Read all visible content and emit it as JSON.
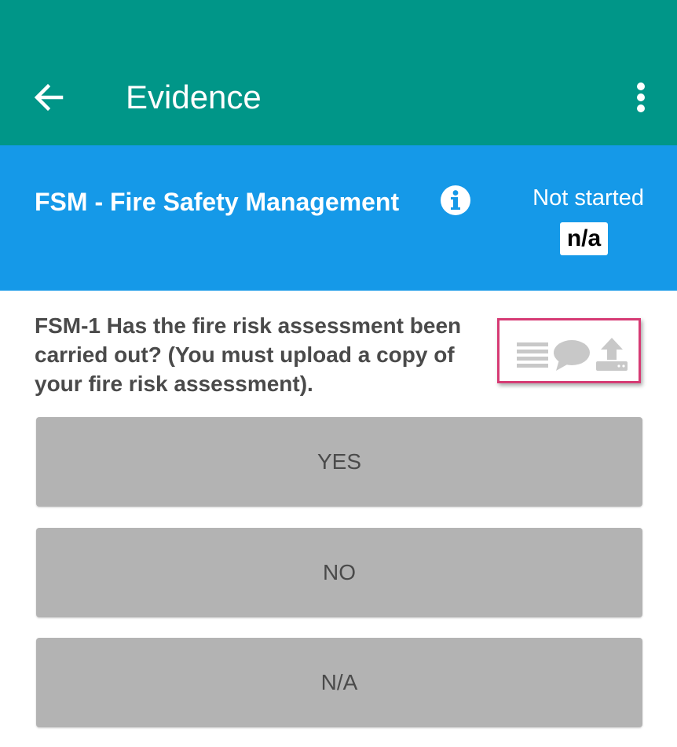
{
  "app_bar": {
    "title": "Evidence",
    "background": "#009688",
    "back_icon": "arrow-back-icon",
    "menu_icon": "more-vert-icon"
  },
  "section": {
    "title": "FSM - Fire Safety Management",
    "info_icon": "info-circle-icon",
    "status": "Not started",
    "score": "n/a",
    "background": "#1599e8"
  },
  "question": {
    "text": "FSM-1 Has the fire risk assessment been carried out?  (You must upload a copy of your fire risk assessment).",
    "actions": [
      {
        "icon": "list-icon"
      },
      {
        "icon": "comment-icon"
      },
      {
        "icon": "upload-icon"
      }
    ],
    "highlight_color": "#d63b74"
  },
  "answers": [
    {
      "label": "YES"
    },
    {
      "label": "NO"
    },
    {
      "label": "N/A"
    }
  ]
}
